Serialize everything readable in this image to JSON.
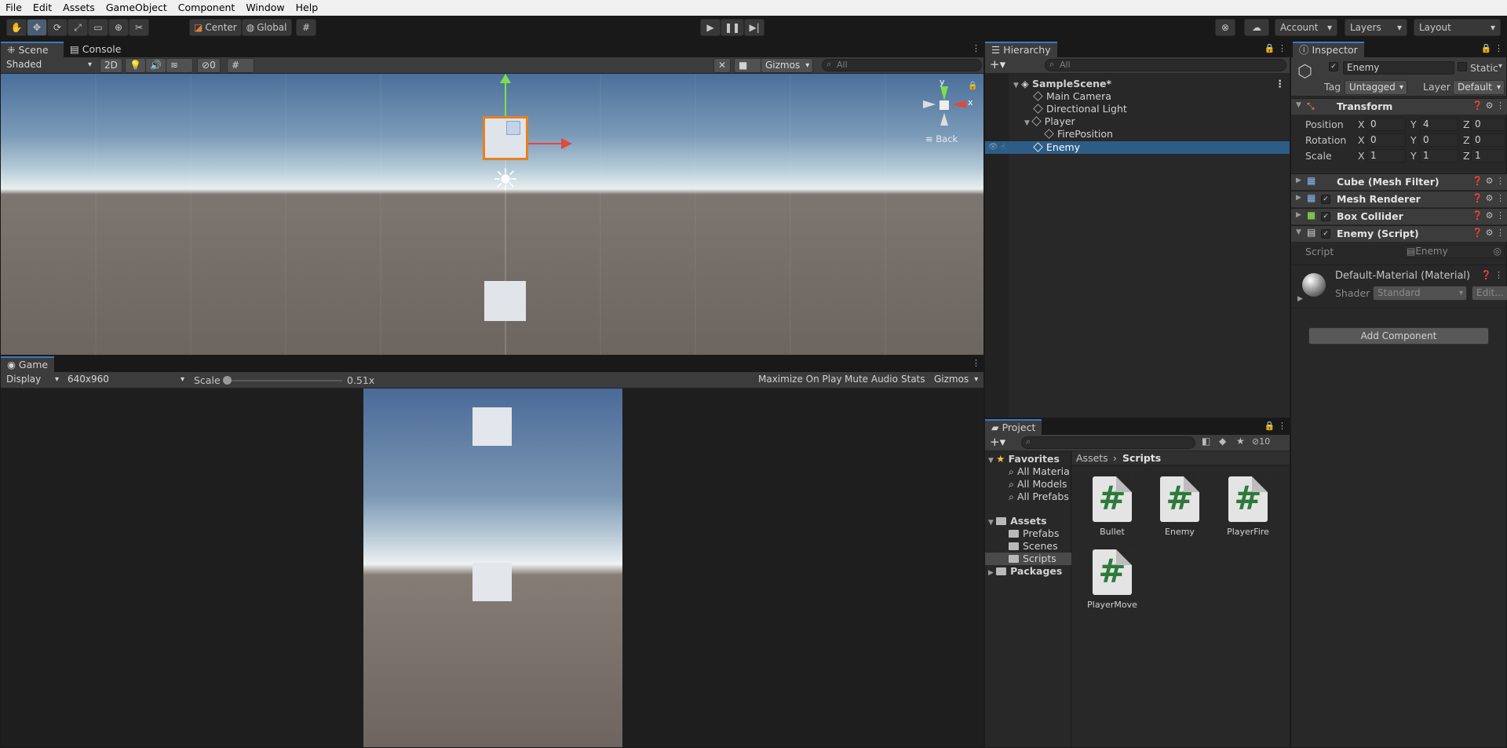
{
  "menu": [
    "File",
    "Edit",
    "Assets",
    "GameObject",
    "Component",
    "Window",
    "Help"
  ],
  "toolbar": {
    "pivot": "Center",
    "space": "Global",
    "account": "Account",
    "layers": "Layers",
    "layout": "Layout"
  },
  "scene": {
    "tab_scene": "Scene",
    "tab_console": "Console",
    "shading": "Shaded",
    "mode2d": "2D",
    "hidden_count": "0",
    "gizmos": "Gizmos",
    "search_placeholder": "All",
    "axis_y": "y",
    "axis_x": "x",
    "view_label": "Back"
  },
  "game": {
    "tab": "Game",
    "display": "Display 1",
    "resolution": "640x960",
    "scale_label": "Scale",
    "scale_value": "0.51x",
    "scale_fraction": 0.0,
    "maximize": "Maximize On Play",
    "mute": "Mute Audio",
    "stats": "Stats",
    "gizmos": "Gizmos"
  },
  "hierarchy": {
    "tab": "Hierarchy",
    "search_placeholder": "All",
    "scene_name": "SampleScene*",
    "items": [
      "Main Camera",
      "Directional Light",
      "Player",
      "FirePosition",
      "Enemy"
    ]
  },
  "inspector": {
    "tab": "Inspector",
    "object_name": "Enemy",
    "static": "Static",
    "tag_label": "Tag",
    "tag": "Untagged",
    "layer_label": "Layer",
    "layer": "Default",
    "transform_title": "Transform",
    "position_label": "Position",
    "rotation_label": "Rotation",
    "scale_label": "Scale",
    "position": {
      "x": "0",
      "y": "4",
      "z": "0"
    },
    "rotation": {
      "x": "0",
      "y": "0",
      "z": "0"
    },
    "scale": {
      "x": "1",
      "y": "1",
      "z": "1"
    },
    "axis": {
      "x": "X",
      "y": "Y",
      "z": "Z"
    },
    "components": [
      "Cube (Mesh Filter)",
      "Mesh Renderer",
      "Box Collider",
      "Enemy (Script)"
    ],
    "script_label": "Script",
    "script_value": "Enemy",
    "material_title": "Default-Material (Material)",
    "shader_label": "Shader",
    "shader": "Standard",
    "edit": "Edit...",
    "add_component": "Add Component"
  },
  "project": {
    "tab": "Project",
    "hidden_count": "10",
    "favorites": "Favorites",
    "fav_items": [
      "All Materia",
      "All Models",
      "All Prefabs"
    ],
    "assets": "Assets",
    "asset_folders": [
      "Prefabs",
      "Scenes",
      "Scripts"
    ],
    "packages": "Packages",
    "breadcrumb": [
      "Assets",
      "Scripts"
    ],
    "files": [
      "Bullet",
      "Enemy",
      "PlayerFire",
      "PlayerMove"
    ],
    "file_glyph": "#"
  },
  "colors": {
    "selection": "#2c5d87",
    "accent": "#3a79bb",
    "script_green": "#2c7a3a"
  }
}
